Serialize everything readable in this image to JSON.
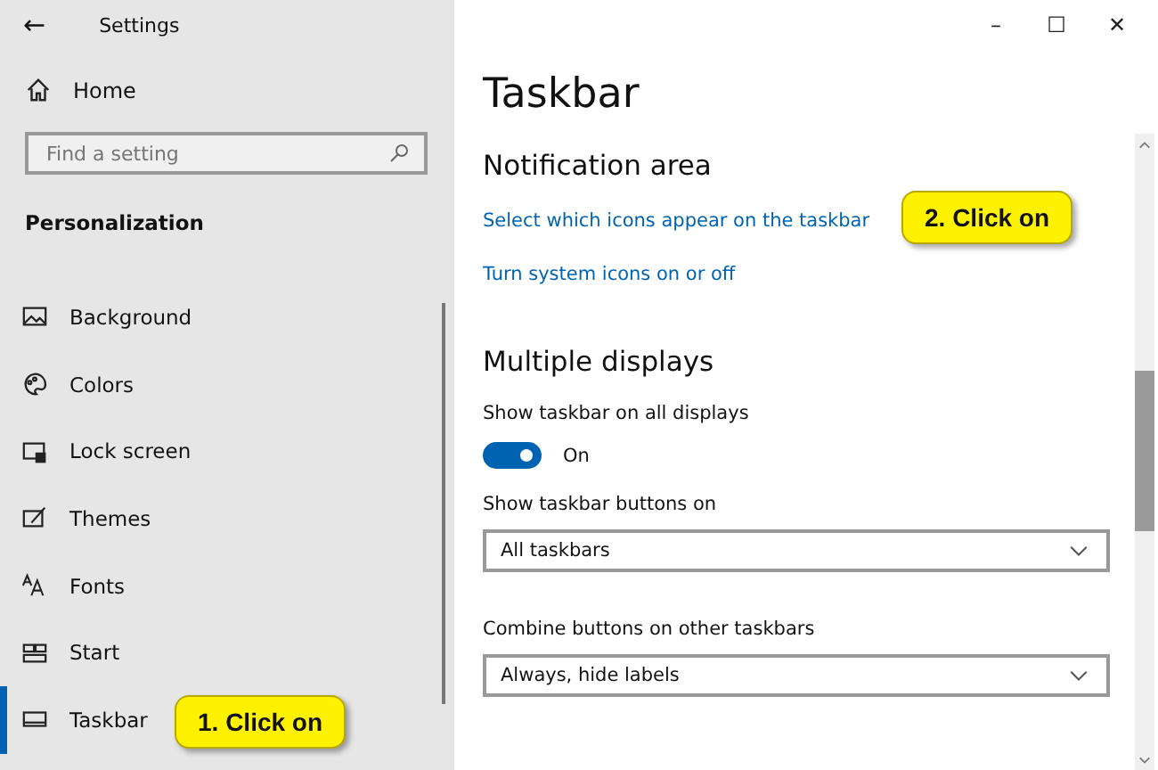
{
  "window": {
    "title": "Settings",
    "back": "←",
    "controls": [
      "–",
      "☐",
      "✕"
    ]
  },
  "sidebar": {
    "home": "Home",
    "search": {
      "placeholder": "Find a setting"
    },
    "section": "Personalization",
    "items": [
      {
        "label": "Background",
        "kind": "background",
        "selected": false
      },
      {
        "label": "Colors",
        "kind": "colors",
        "selected": false
      },
      {
        "label": "Lock screen",
        "kind": "lock",
        "selected": false
      },
      {
        "label": "Themes",
        "kind": "themes",
        "selected": false
      },
      {
        "label": "Fonts",
        "kind": "fonts",
        "selected": false
      },
      {
        "label": "Start",
        "kind": "start",
        "selected": false
      },
      {
        "label": "Taskbar",
        "kind": "taskbar",
        "selected": true
      }
    ]
  },
  "page": {
    "title": "Taskbar",
    "sections": [
      {
        "heading": "Notification area",
        "links": [
          "Select which icons appear on the taskbar",
          "Turn system icons on or off"
        ]
      },
      {
        "heading": "Multiple displays",
        "toggle": {
          "label": "Show taskbar on all displays",
          "on": true,
          "state": "On"
        },
        "dropdowns": [
          {
            "label": "Show taskbar buttons on",
            "value": "All taskbars"
          },
          {
            "label": "Combine buttons on other taskbars",
            "value": "Always, hide labels"
          }
        ]
      }
    ]
  },
  "callouts": [
    "1. Click on",
    "2. Click on"
  ]
}
